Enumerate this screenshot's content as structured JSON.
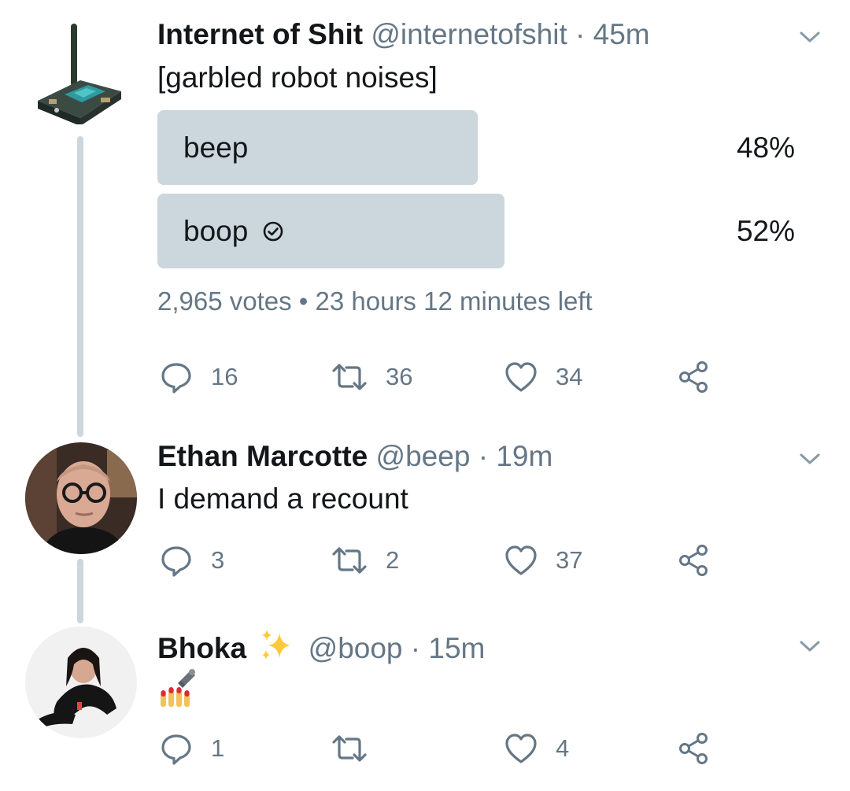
{
  "tweets": [
    {
      "name": "Internet of Shit",
      "handle": "@internetofshit",
      "separator": "·",
      "time": "45m",
      "text": "[garbled robot noises]",
      "poll": {
        "options": [
          {
            "label": "beep",
            "percent": "48%",
            "share": 0.48,
            "selected": false
          },
          {
            "label": "boop",
            "percent": "52%",
            "share": 0.52,
            "selected": true
          }
        ],
        "meta": "2,965 votes • 23 hours 12 minutes left"
      },
      "replies": "16",
      "retweets": "36",
      "likes": "34"
    },
    {
      "name": "Ethan Marcotte",
      "handle": "@beep",
      "separator": "·",
      "time": "19m",
      "text": "I demand a recount",
      "replies": "3",
      "retweets": "2",
      "likes": "37"
    },
    {
      "name": "Bhoka",
      "name_emoji": "sparkles",
      "handle": "@boop",
      "separator": "·",
      "time": "15m",
      "text_emoji": "nail-polish",
      "replies": "1",
      "retweets": "",
      "likes": "4"
    }
  ],
  "colors": {
    "muted": "#657786",
    "divider": "#ccd6dd",
    "text": "#14171a"
  },
  "icons": [
    "chevron-down-icon",
    "reply-icon",
    "retweet-icon",
    "heart-icon",
    "share-icon",
    "check-circle-icon",
    "sparkles-icon",
    "nail-polish-icon"
  ]
}
